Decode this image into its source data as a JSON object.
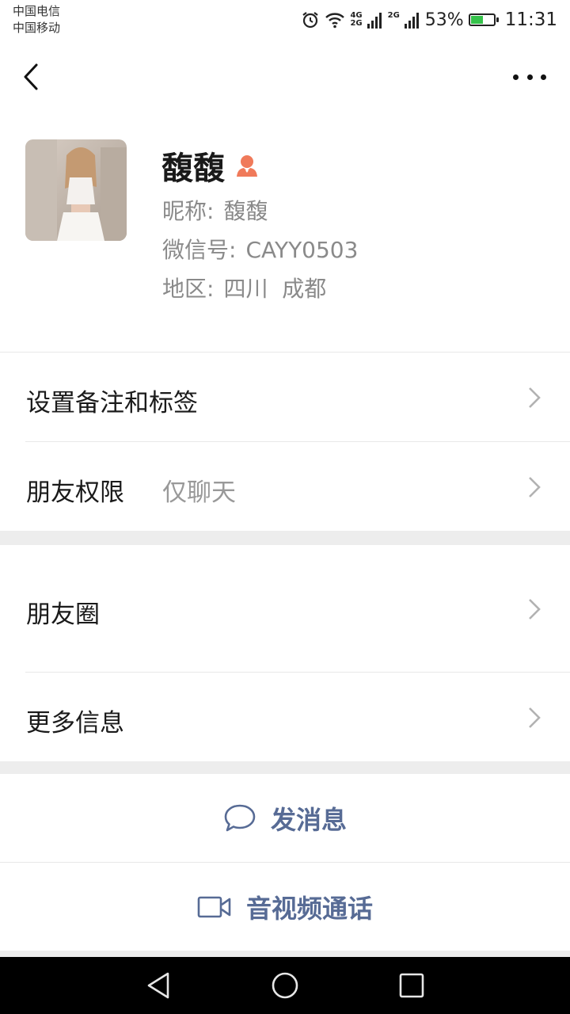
{
  "status_bar": {
    "carrier1": "中国电信",
    "carrier2": "中国移动",
    "net1_top": "4G",
    "net1_bottom": "2G",
    "net2": "2G",
    "battery_percent": "53%",
    "battery_level": 0.53,
    "time": "11:31"
  },
  "nav": {
    "back_icon": "chevron-left-icon",
    "more_icon": "more-dots-icon"
  },
  "profile": {
    "name": "馥馥",
    "gender_icon": "female-icon",
    "nickname_label": "昵称:",
    "nickname": "馥馥",
    "wechat_id_label": "微信号:",
    "wechat_id": "CAYY0503",
    "region_label": "地区:",
    "region": "四川  成都"
  },
  "menu": {
    "remark_tags": "设置备注和标签",
    "permissions": "朋友权限",
    "permissions_value": "仅聊天",
    "moments": "朋友圈",
    "more_info": "更多信息"
  },
  "actions": {
    "send_message": "发消息",
    "video_call": "音视频通话"
  },
  "colors": {
    "link": "#576b95",
    "accent_orange": "#f07a5a",
    "battery_green": "#35c24a"
  }
}
